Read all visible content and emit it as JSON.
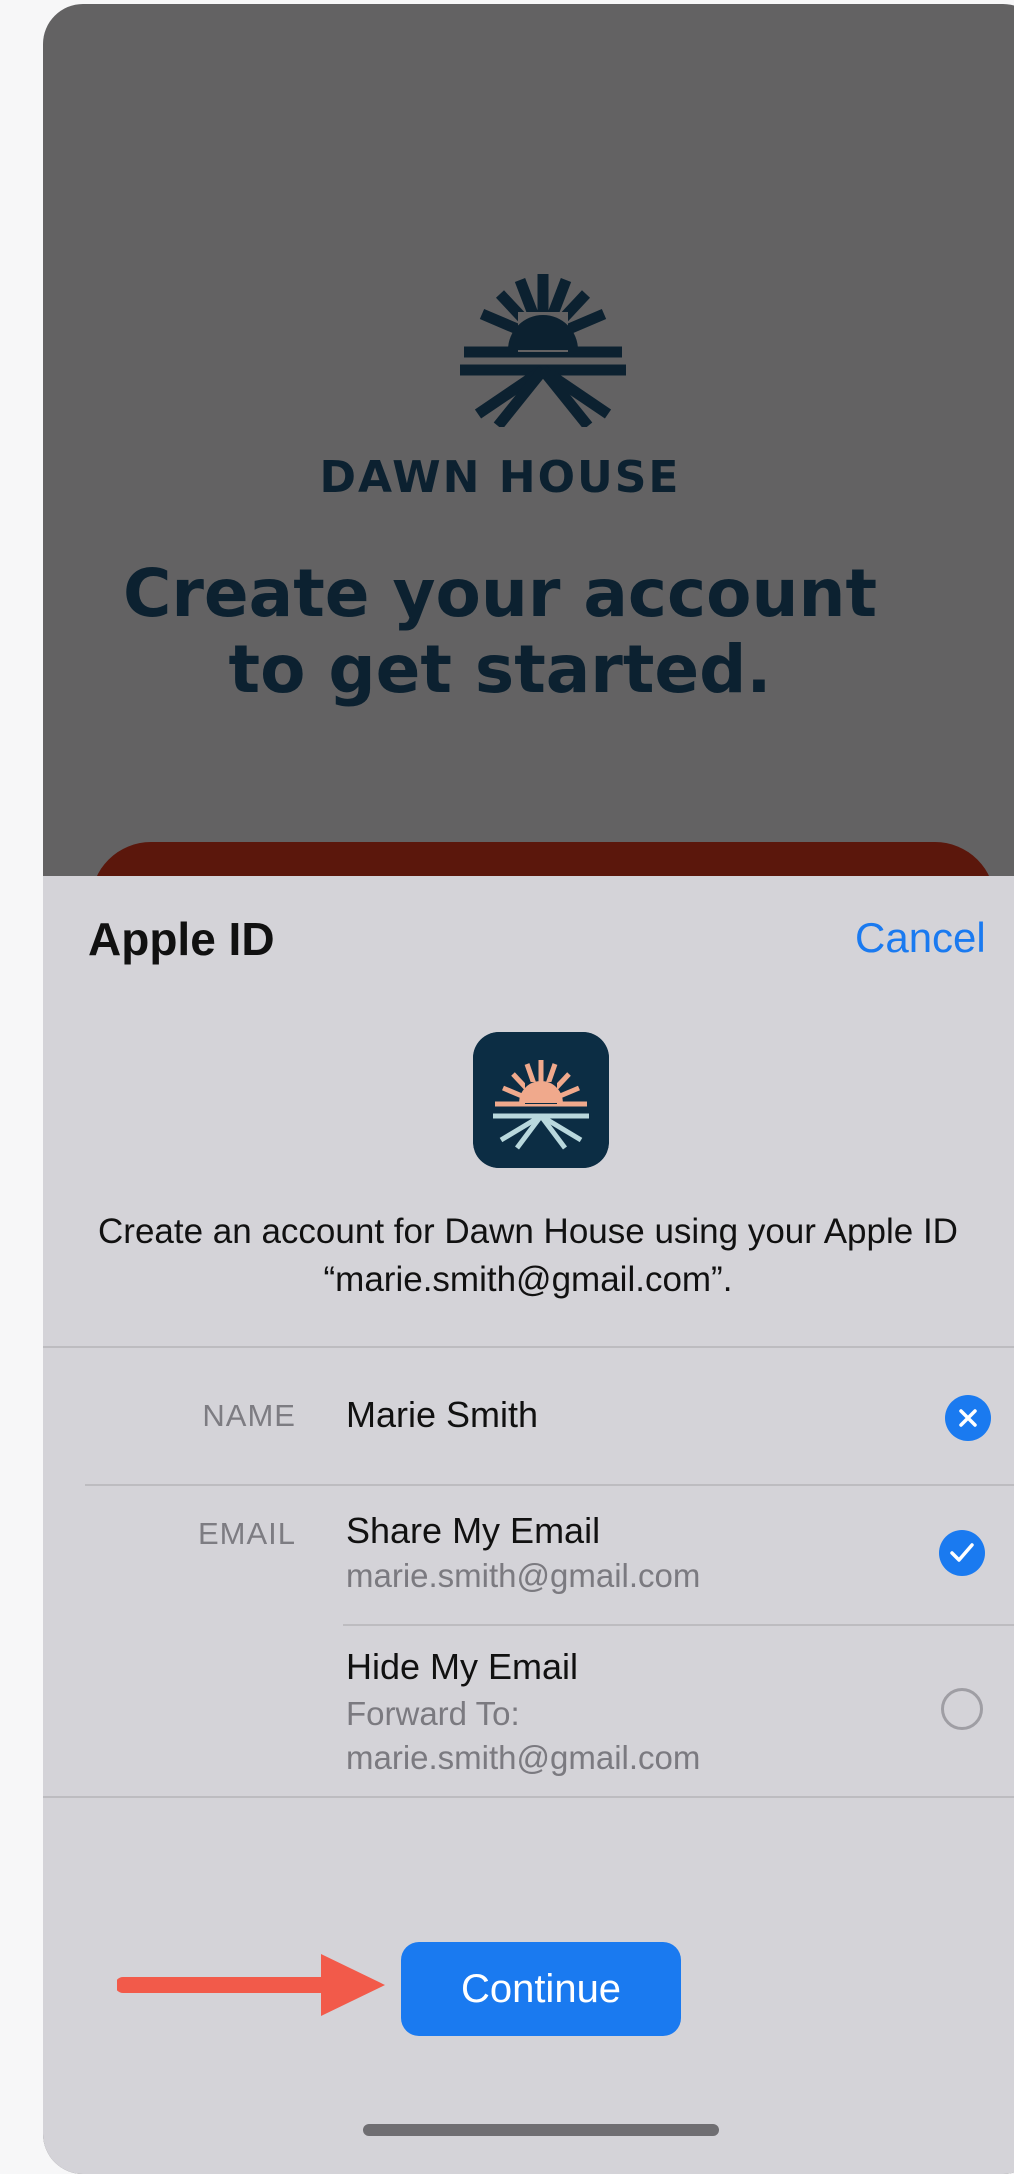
{
  "background_app": {
    "brand_name": "DAWN HOUSE",
    "headline_line1": "Create your account",
    "headline_line2": "to get started.",
    "logo_icon": "sunrise-logo-icon"
  },
  "sheet": {
    "title": "Apple ID",
    "cancel_label": "Cancel",
    "description_line1": "Create an account for Dawn House using your Apple ID",
    "description_line2": "“marie.smith@gmail.com”.",
    "name": {
      "label": "NAME",
      "value": "Marie Smith",
      "action_icon": "clear-icon"
    },
    "email": {
      "label": "EMAIL",
      "options": [
        {
          "title": "Share My Email",
          "subtitle_line1": "marie.smith@gmail.com",
          "subtitle_line2": "",
          "selected": true
        },
        {
          "title": "Hide My Email",
          "subtitle_line1": "Forward To:",
          "subtitle_line2": "marie.smith@gmail.com",
          "selected": false
        }
      ]
    },
    "continue_label": "Continue"
  },
  "colors": {
    "accent_blue": "#1a7af0",
    "brand_navy": "#0c2130",
    "annotation_arrow": "#f25a4a"
  }
}
